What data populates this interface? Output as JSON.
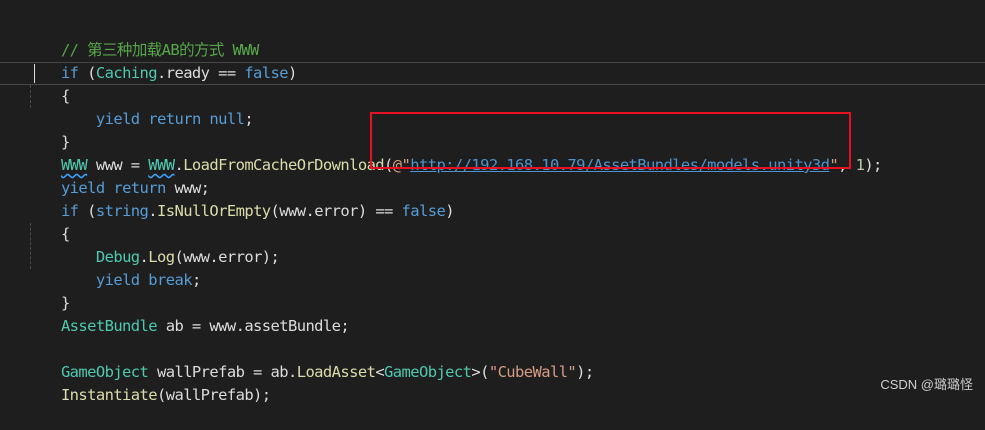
{
  "comment": "// 第三种加载AB的方式 WWW",
  "lines": {
    "l2": {
      "kw_if": "if",
      "p1": " (",
      "caching": "Caching",
      "p2": ".ready == ",
      "false": "false",
      "p3": ")"
    },
    "l3": {
      "brace": "{"
    },
    "l4": {
      "indent": "    ",
      "yield": "yield",
      "sp": " ",
      "ret": "return",
      "null": " null",
      "semi": ";"
    },
    "l5": {
      "brace": "}"
    },
    "l6": {
      "type1": "WWW",
      "mid": " www = ",
      "type2": "WWW",
      "dot": ".",
      "method": "LoadFromCacheOrDownload",
      "open": "(",
      "verbatim": "@\"",
      "url": "http://192.168.10.79/AssetBundles/models.unity3d",
      "endq": "\"",
      "rest": ", ",
      "num": "1",
      "close": ");"
    },
    "l7": {
      "yield": "yield",
      "sp": " ",
      "ret": "return",
      "rest": " www;"
    },
    "l8": {
      "kw_if": "if",
      "p1": " (",
      "string": "string",
      "dot": ".",
      "method": "IsNullOrEmpty",
      "args": "(www.error) == ",
      "false": "false",
      "p3": ")"
    },
    "l9": {
      "brace": "{"
    },
    "l10": {
      "indent": "    ",
      "debug": "Debug",
      "dot": ".",
      "log": "Log",
      "args": "(www.error);"
    },
    "l11": {
      "indent": "    ",
      "yield": "yield",
      "sp": " ",
      "brk": "break",
      "semi": ";"
    },
    "l12": {
      "brace": "}"
    },
    "l13": {
      "type": "AssetBundle",
      "rest": " ab = www.assetBundle;"
    },
    "l15": {
      "type": "GameObject",
      "mid": " wallPrefab = ab.",
      "method": "LoadAsset",
      "lt": "<",
      "gtype": "GameObject",
      "gt": ">(",
      "str": "\"CubeWall\"",
      "close": ");"
    },
    "l16": {
      "method": "Instantiate",
      "rest": "(wallPrefab);"
    }
  },
  "watermark": "CSDN @璐璐怪",
  "colors": {
    "background": "#1e1e1e",
    "keyword": "#569cd6",
    "type": "#4ec9b0",
    "method": "#dcdcaa",
    "comment": "#57a64a",
    "string": "#d69d85",
    "highlight": "#e81123"
  }
}
